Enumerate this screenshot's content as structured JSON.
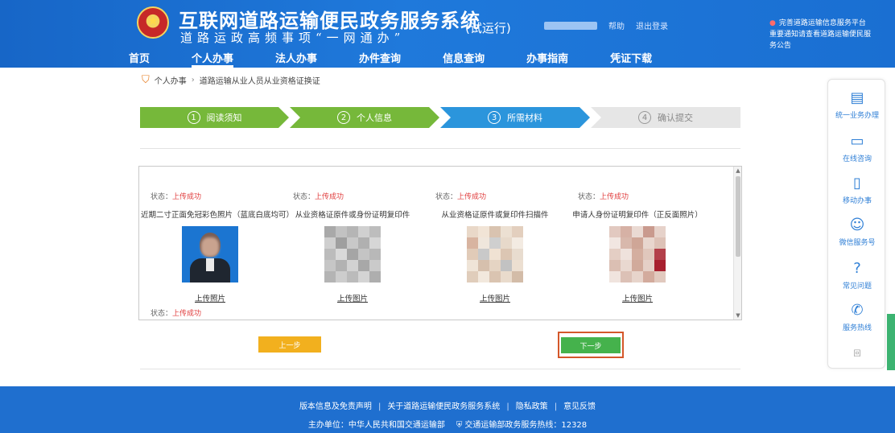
{
  "header": {
    "title": "互联网道路运输便民政务服务系统",
    "slogan": "道路运政高频事项“一网通办”",
    "trial_tag": "(试运行)",
    "user_links": [
      "帮助",
      "退出登录"
    ],
    "notice_lines": [
      "完善道路运输信息服务平台",
      "重要通知请查看道路运输便民服务公告"
    ]
  },
  "nav": [
    "首页",
    "个人办事",
    "法人办事",
    "办件查询",
    "信息查询",
    "办事指南",
    "凭证下载"
  ],
  "breadcrumb": [
    "个人办事",
    "道路运输从业人员从业资格证换证"
  ],
  "steps": [
    {
      "num": "1",
      "label": "阅读须知",
      "state": "done"
    },
    {
      "num": "2",
      "label": "个人信息",
      "state": "done"
    },
    {
      "num": "3",
      "label": "所需材料",
      "state": "current"
    },
    {
      "num": "4",
      "label": "确认提交",
      "state": "todo"
    }
  ],
  "documents": [
    {
      "status_label": "状态：",
      "status_value": "上传成功",
      "desc": "近期二寸正面免冠彩色照片（蓝底白底均可）",
      "upload": "上传照片",
      "thumb": "photo"
    },
    {
      "status_label": "状态：",
      "status_value": "上传成功",
      "desc": "从业资格证原件或身份证明复印件",
      "upload": "上传图片",
      "thumb": "gray"
    },
    {
      "status_label": "状态：",
      "status_value": "上传成功",
      "desc": "从业资格证原件或复印件扫描件",
      "upload": "上传图片",
      "thumb": "paper"
    },
    {
      "status_label": "状态：",
      "status_value": "上传成功",
      "desc": "申请人身份证明复印件（正反面照片）",
      "upload": "上传图片",
      "thumb": "pink"
    }
  ],
  "extra_status": {
    "label": "状态：",
    "value": "上传成功"
  },
  "buttons": {
    "prev": "上一步",
    "next": "下一步"
  },
  "float_bar": [
    {
      "icon": "form-icon",
      "label": "统一业务办理"
    },
    {
      "icon": "chat-icon",
      "label": "在线咨询"
    },
    {
      "icon": "phone-app-icon",
      "label": "移动办事"
    },
    {
      "icon": "wechat-icon",
      "label": "微信服务号"
    },
    {
      "icon": "question-icon",
      "label": "常见问题"
    },
    {
      "icon": "telephone-icon",
      "label": "服务热线"
    }
  ],
  "float_more": "回",
  "footer": {
    "links": [
      "版本信息及免责声明",
      "关于道路运输便民政务服务系统",
      "隐私政策",
      "意见反馈"
    ],
    "info_left": "主办单位：中华人民共和国交通运输部",
    "info_right": "交通运输部政务服务热线：12328"
  },
  "colors": {
    "header_blue": "#1a6fd2",
    "step_done": "#76b83a",
    "step_current": "#2b95dc",
    "step_todo": "#e6e6e6",
    "prev_button": "#f2b01e",
    "next_button": "#45b24c",
    "highlight_border": "#d4572a",
    "status_red": "#e03c3c"
  }
}
